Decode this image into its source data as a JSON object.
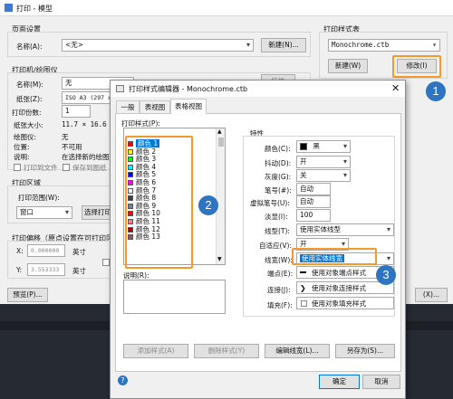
{
  "back_window": {
    "title": "打印 - 模型",
    "page_setup": {
      "group": "页面设置",
      "name_label": "名称(A):",
      "name_value": "<无>",
      "add_button": "新建(N)..."
    },
    "plot_style_table": {
      "group": "打印样式表",
      "value": "Monochrome.ctb",
      "new_button": "新建(W)",
      "edit_button": "修改(I)"
    },
    "printer": {
      "group": "打印机/绘图仪",
      "name_label": "名称(M):",
      "name_value": "无",
      "properties_button": "特性",
      "paper_label": "纸张(Z):",
      "paper_value": "ISO A3 (297 x",
      "copies_label": "打印份数:",
      "copies_value": "1"
    },
    "info": {
      "paper_size_label": "纸张大小:",
      "paper_size_value": "11.7 × 16.6",
      "plotter_label": "绘图仪:",
      "plotter_value": "无",
      "location_label": "位置:",
      "location_value": "不可用",
      "desc_label": "说明:",
      "desc_value": "在选择新的绘图"
    },
    "plot_to_file": "打印到文件",
    "save_changes": "保存到图纸",
    "plot_area": {
      "group": "打印区域",
      "what_label": "打印范围(W):",
      "what_value": "窗口",
      "window_button": "选择打印"
    },
    "plot_offset": {
      "group": "打印偏移（原点设置在可打印区",
      "x_label": "X:",
      "x_value": "0.000000",
      "x_unit": "英寸",
      "y_label": "Y:",
      "y_value": "3.553333",
      "y_unit": "英寸"
    },
    "preview_button": "预览(P)...",
    "extra_button": "(X)..."
  },
  "dialog": {
    "title": "打印样式编辑器 - Monochrome.ctb",
    "tabs": [
      "一般",
      "表视图",
      "表格视图"
    ],
    "active_tab": 2,
    "styles_label": "打印样式(P):",
    "styles": [
      {
        "name": "颜色 1",
        "color": "#ff0000"
      },
      {
        "name": "颜色 2",
        "color": "#ffff00"
      },
      {
        "name": "颜色 3",
        "color": "#00ff00"
      },
      {
        "name": "颜色 4",
        "color": "#00ffff"
      },
      {
        "name": "颜色 5",
        "color": "#0000ff"
      },
      {
        "name": "颜色 6",
        "color": "#ff00ff"
      },
      {
        "name": "颜色 7",
        "color": "#ffffff"
      },
      {
        "name": "颜色 8",
        "color": "#414141"
      },
      {
        "name": "颜色 9",
        "color": "#808080"
      },
      {
        "name": "颜色 10",
        "color": "#ff0000"
      },
      {
        "name": "颜色 11",
        "color": "#ff7f7f"
      },
      {
        "name": "颜色 12",
        "color": "#a50000"
      },
      {
        "name": "颜色 13",
        "color": "#a55252"
      }
    ],
    "description_label": "说明(R):",
    "properties": {
      "group": "特性",
      "color_label": "颜色(C):",
      "color_value": "黑",
      "color_swatch": "#000000",
      "dither_label": "抖动(D):",
      "dither_value": "开",
      "grayscale_label": "灰度(G):",
      "grayscale_value": "关",
      "pen_label": "笔号(#):",
      "pen_value": "自动",
      "virtual_pen_label": "虚拟笔号(U):",
      "virtual_pen_value": "自动",
      "screening_label": "淡显(I):",
      "screening_value": "100",
      "linetype_label": "线型(T):",
      "linetype_value": "使用实体线型",
      "adaptive_label": "自适应(V):",
      "adaptive_value": "开",
      "lineweight_label": "线宽(W):",
      "lineweight_value": "使用实体线宽",
      "endstyle_label": "端点(E):",
      "endstyle_value": "使用对象端点样式",
      "joinstyle_label": "连接(J):",
      "joinstyle_value": "使用对象连接样式",
      "fillstyle_label": "填充(F):",
      "fillstyle_value": "使用对象填充样式"
    },
    "add_style_button": "添加样式(A)",
    "delete_style_button": "删除样式(Y)",
    "edit_lineweights_button": "编辑线宽(L)...",
    "save_as_button": "另存为(S)...",
    "ok_button": "确定",
    "cancel_button": "取消",
    "help_icon": "?"
  },
  "callouts": [
    "1",
    "2",
    "3"
  ],
  "colors": {
    "callout": "#2f74c0",
    "highlight": "#f39a2c",
    "selection": "#0078d7"
  }
}
